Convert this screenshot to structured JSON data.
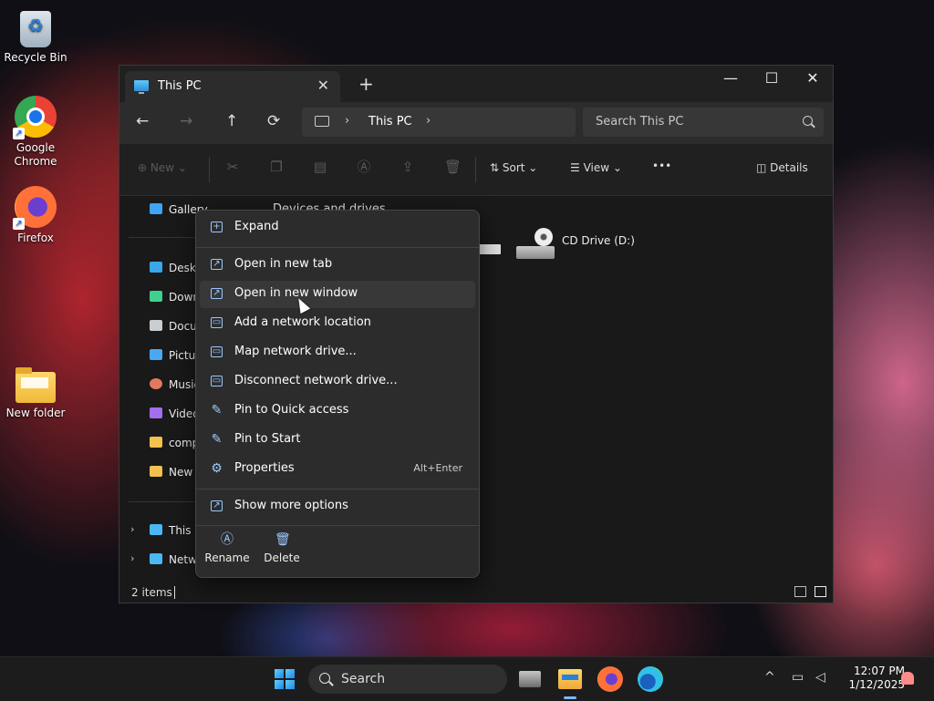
{
  "desktop": {
    "icons": [
      {
        "label": "Recycle Bin"
      },
      {
        "label": "Google Chrome"
      },
      {
        "label": "Firefox"
      },
      {
        "label": "New folder"
      }
    ]
  },
  "window": {
    "tab_title": "This PC",
    "tab_close": "✕",
    "new_tab": "+",
    "controls": {
      "minimize": "—",
      "maximize": "☐",
      "close": "✕"
    }
  },
  "nav": {
    "back": "←",
    "forward": "→",
    "up": "↑",
    "refresh": "⟳",
    "breadcrumb": "This PC",
    "search_placeholder": "Search This PC"
  },
  "toolbar": {
    "new_label": "New",
    "sort_label": "Sort",
    "view_label": "View",
    "more_label": "•••",
    "details_label": "Details"
  },
  "sidebar": {
    "items": [
      {
        "label": "Gallery",
        "color": "#3fa4f5"
      },
      {
        "label": "Deskt",
        "color": "#3aa7e8"
      },
      {
        "label": "Down",
        "color": "#3fd08f"
      },
      {
        "label": "Docu",
        "color": "#c9cdd2"
      },
      {
        "label": "Pictur",
        "color": "#4aa8f0"
      },
      {
        "label": "Music",
        "color": "#e07a5f"
      },
      {
        "label": "Video",
        "color": "#a46ef0"
      },
      {
        "label": "comp",
        "color": "#f3c150"
      },
      {
        "label": "New f",
        "color": "#f3c150"
      },
      {
        "label": "This P",
        "color": "#4ab8f5"
      },
      {
        "label": "Netw",
        "color": "#4ab8f5"
      }
    ]
  },
  "content": {
    "section_header": "Devices and drives",
    "drives": [
      {
        "label": "CD Drive (D:)"
      }
    ]
  },
  "status": {
    "item_count": "2 items"
  },
  "context_menu": {
    "items": [
      {
        "label": "Expand",
        "icon": "+"
      },
      {
        "label": "Open in new tab",
        "icon": "↗"
      },
      {
        "label": "Open in new window",
        "icon": "↗"
      },
      {
        "label": "Add a network location",
        "icon": "▭"
      },
      {
        "label": "Map network drive...",
        "icon": "▭"
      },
      {
        "label": "Disconnect network drive...",
        "icon": "▭"
      },
      {
        "label": "Pin to Quick access",
        "icon": "✎"
      },
      {
        "label": "Pin to Start",
        "icon": "✎"
      },
      {
        "label": "Properties",
        "icon": "⚙",
        "shortcut": "Alt+Enter"
      },
      {
        "label": "Show more options",
        "icon": "↗"
      }
    ],
    "rename_label": "Rename",
    "delete_label": "Delete"
  },
  "taskbar": {
    "search_placeholder": "Search",
    "time": "12:07 PM",
    "date": "1/12/2025",
    "tray_chevron": "^"
  }
}
